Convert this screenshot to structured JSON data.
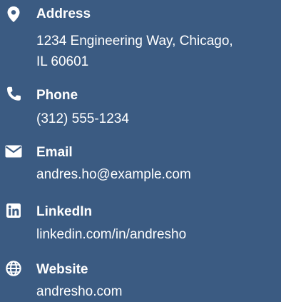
{
  "contact": {
    "address": {
      "label": "Address",
      "value_line1": "1234 Engineering Way, Chicago,",
      "value_line2": "IL 60601",
      "icon": "map-pin-icon"
    },
    "phone": {
      "label": "Phone",
      "value": "(312) 555-1234",
      "icon": "phone-icon"
    },
    "email": {
      "label": "Email",
      "value": "andres.ho@example.com",
      "icon": "envelope-icon"
    },
    "linkedin": {
      "label": "LinkedIn",
      "value": "linkedin.com/in/andresho",
      "icon": "linkedin-icon"
    },
    "website": {
      "label": "Website",
      "value": "andresho.com",
      "icon": "globe-icon"
    }
  },
  "colors": {
    "background": "#3b5b82",
    "text": "#ffffff"
  }
}
